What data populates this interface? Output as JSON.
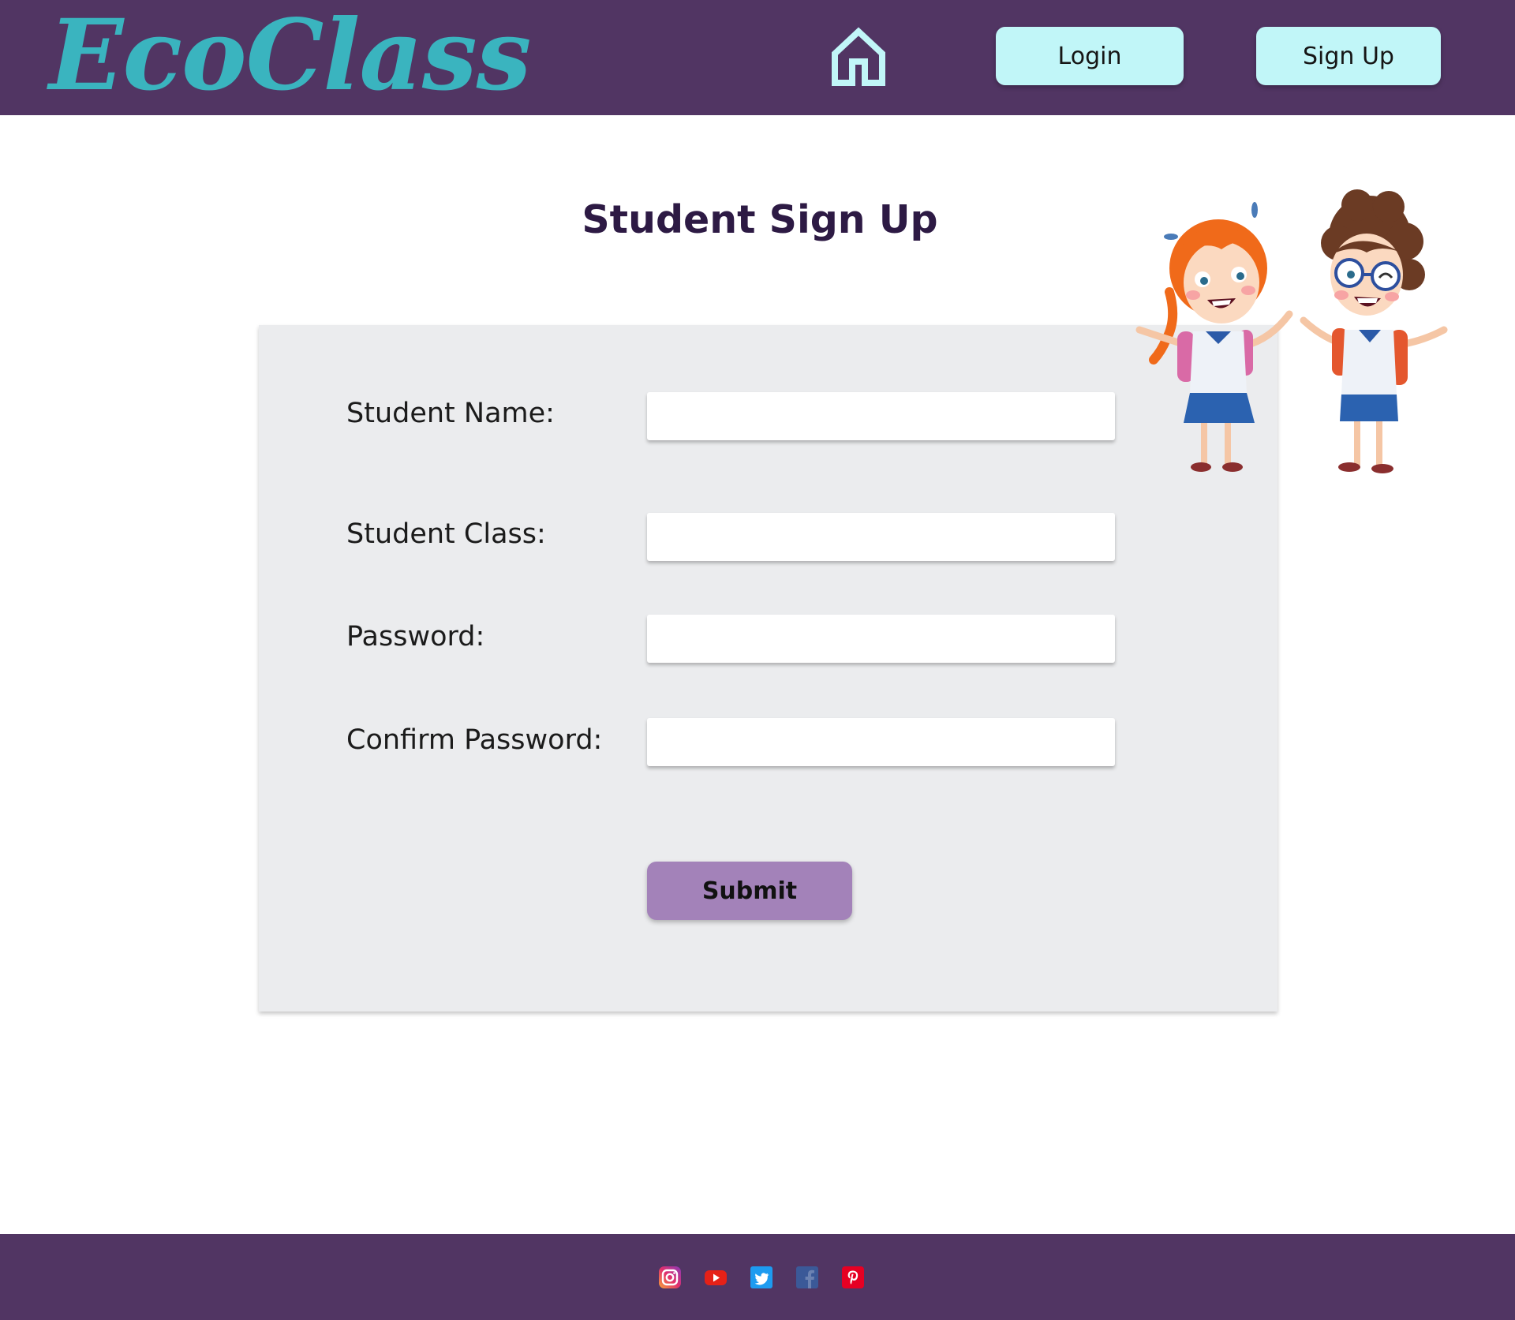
{
  "header": {
    "logo_text": "EcoClass",
    "home_icon": "home-icon",
    "login_label": "Login",
    "signup_label": "Sign Up"
  },
  "main": {
    "title": "Student Sign Up",
    "form": {
      "fields": [
        {
          "label": "Student Name:",
          "value": "",
          "placeholder": ""
        },
        {
          "label": "Student Class:",
          "value": "",
          "placeholder": ""
        },
        {
          "label": "Password:",
          "value": "",
          "placeholder": ""
        },
        {
          "label": "Confirm Password:",
          "value": "",
          "placeholder": ""
        }
      ],
      "submit_label": "Submit"
    },
    "illustration": "two-cartoon-students"
  },
  "footer": {
    "social_icons": [
      "instagram-icon",
      "youtube-icon",
      "twitter-icon",
      "facebook-icon",
      "pinterest-icon"
    ]
  },
  "colors": {
    "header_bg": "#513563",
    "logo": "#3ab4bf",
    "nav_button_bg": "#c1f6f8",
    "card_bg": "#ebecee",
    "submit_bg": "#a382b9",
    "title": "#2d1a44"
  }
}
